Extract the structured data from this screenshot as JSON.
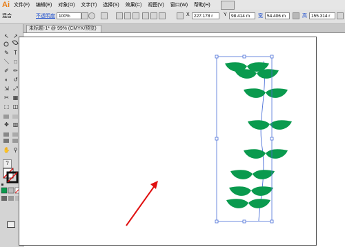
{
  "app": {
    "logo": "Ai"
  },
  "menu": {
    "items": [
      "文件(F)",
      "编辑(E)",
      "对象(O)",
      "文字(T)",
      "选择(S)",
      "效果(C)",
      "视图(V)",
      "窗口(W)",
      "帮助(H)"
    ]
  },
  "options_bar": {
    "blend_label": "混合",
    "opacity_label": "不透明度",
    "opacity_value": "100%",
    "x_label": "X",
    "x_value": "227.178 r",
    "y_label": "Y",
    "y_value": "98.414 m",
    "w_label": "宽",
    "w_value": "54.406 m",
    "h_label": "高",
    "h_value": "155.314 r"
  },
  "tools": {
    "glyphs": [
      "↖",
      "↗",
      "✎",
      "T",
      "＼",
      "□",
      "✐",
      "✏",
      "◐",
      "↺",
      "⇲",
      "⤢",
      "✂",
      "▦",
      "⬚",
      "◫",
      "✥",
      "▥",
      "✋",
      "⚲"
    ],
    "help": "?"
  },
  "document": {
    "tab_title": "未标题-1* @ 99% (CMYK/预览)"
  },
  "artwork": {
    "leaf_color": "#0a9a4e",
    "selection_color": "#4a6fd8",
    "arrow_color": "#e01010"
  }
}
